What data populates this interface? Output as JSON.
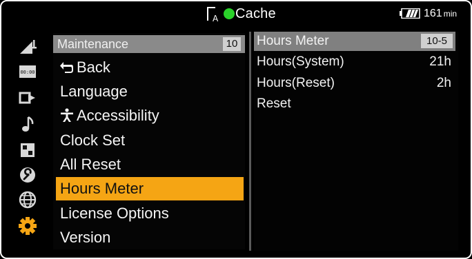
{
  "status_bar": {
    "media_letter": "A",
    "status_label": "Cache",
    "battery_time": "161",
    "battery_unit": "min"
  },
  "categories": [
    {
      "icon": "camera-icon"
    },
    {
      "icon": "timecode-icon"
    },
    {
      "icon": "output-icon"
    },
    {
      "icon": "audio-icon"
    },
    {
      "icon": "display-icon"
    },
    {
      "icon": "wrench-icon"
    },
    {
      "icon": "network-icon"
    },
    {
      "icon": "gear-icon",
      "active": true
    }
  ],
  "menu": {
    "header_title": "Maintenance",
    "header_page": "10",
    "items": [
      {
        "label": "Back",
        "glyph": "↰"
      },
      {
        "label": "Language",
        "glyph": ""
      },
      {
        "label": "Accessibility",
        "glyph": "♿"
      },
      {
        "label": "Clock Set",
        "glyph": ""
      },
      {
        "label": "All Reset",
        "glyph": ""
      },
      {
        "label": "Hours Meter",
        "glyph": "",
        "selected": true
      },
      {
        "label": "License Options",
        "glyph": ""
      },
      {
        "label": "Version",
        "glyph": ""
      }
    ]
  },
  "detail": {
    "title": "Hours Meter",
    "code": "10-5",
    "rows": [
      {
        "label": "Hours(System)",
        "value": "21h"
      },
      {
        "label": "Hours(Reset)",
        "value": "2h"
      },
      {
        "label": "Reset",
        "value": ""
      }
    ]
  },
  "colors": {
    "highlight": "#f5a514",
    "status_ok": "#2ad12a",
    "header_gray": "#8a8a8a"
  }
}
